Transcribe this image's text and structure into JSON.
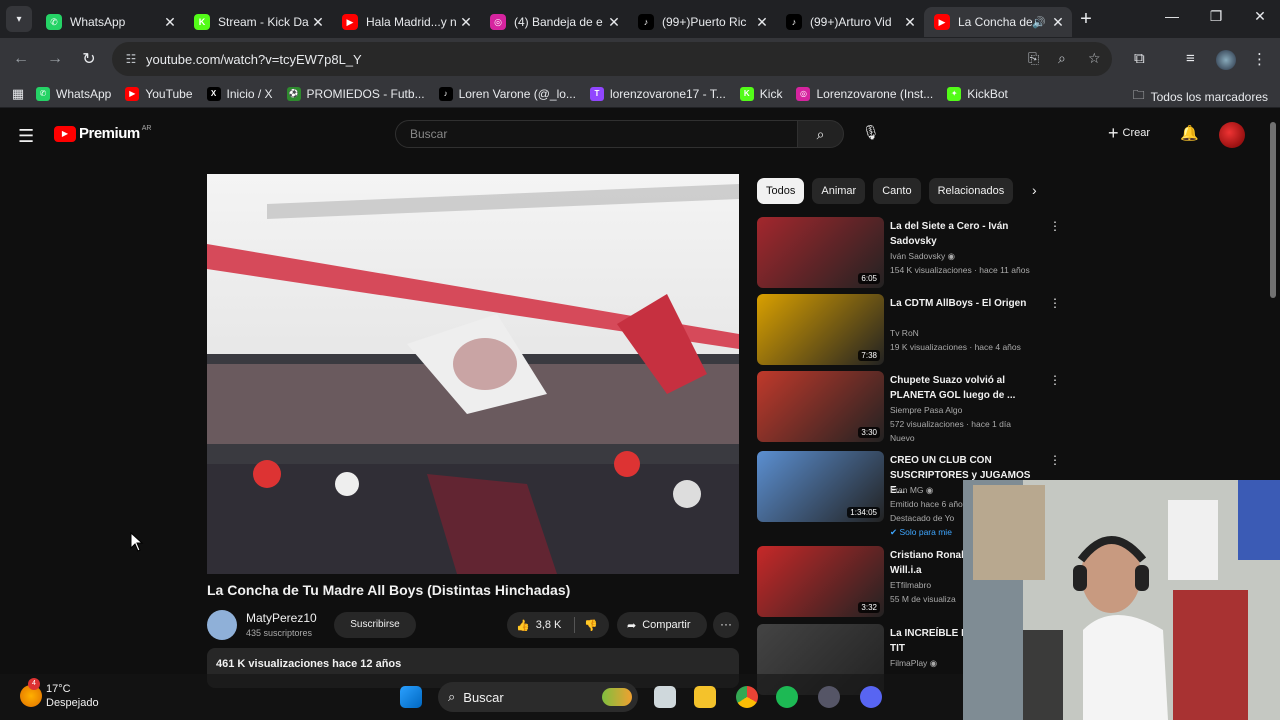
{
  "browser": {
    "tabs": [
      {
        "title": "WhatsApp",
        "favicon_color": "#25d366",
        "favicon_glyph": "✆",
        "active": false
      },
      {
        "title": "Stream - Kick Da",
        "favicon_color": "#53fc18",
        "favicon_glyph": "K",
        "active": false
      },
      {
        "title": "Hala Madrid...y n",
        "favicon_color": "#ff0000",
        "favicon_glyph": "▶",
        "active": false
      },
      {
        "title": "(4) Bandeja de e",
        "favicon_color": "#d6249f",
        "favicon_glyph": "◎",
        "active": false
      },
      {
        "title": "(99+)Puerto Ric",
        "favicon_color": "#000000",
        "favicon_glyph": "♪",
        "active": false
      },
      {
        "title": "(99+)Arturo Vid",
        "favicon_color": "#000000",
        "favicon_glyph": "♪",
        "active": false
      },
      {
        "title": "La Concha de",
        "favicon_color": "#ff0000",
        "favicon_glyph": "▶",
        "active": true
      }
    ],
    "url": "youtube.com/watch?v=tcyEW7p8L_Y",
    "bookmarks": [
      {
        "label": "WhatsApp",
        "favicon_color": "#25d366",
        "glyph": "✆"
      },
      {
        "label": "YouTube",
        "favicon_color": "#ff0000",
        "glyph": "▶"
      },
      {
        "label": "Inicio / X",
        "favicon_color": "#000000",
        "glyph": "X"
      },
      {
        "label": "PROMIEDOS - Futb...",
        "favicon_color": "#2e8b2e",
        "glyph": "⚽"
      },
      {
        "label": "Loren Varone (@_lo...",
        "favicon_color": "#000000",
        "glyph": "♪"
      },
      {
        "label": "lorenzovarone17 - T...",
        "favicon_color": "#9146ff",
        "glyph": "T"
      },
      {
        "label": "Kick",
        "favicon_color": "#53fc18",
        "glyph": "K"
      },
      {
        "label": "Lorenzovarone (Inst...",
        "favicon_color": "#d6249f",
        "glyph": "◎"
      },
      {
        "label": "KickBot",
        "favicon_color": "#53fc18",
        "glyph": "✦"
      }
    ],
    "all_bookmarks": "Todos los marcadores"
  },
  "youtube": {
    "logo_text": "Premium",
    "country_code": "AR",
    "search_placeholder": "Buscar",
    "create_label": "Crear",
    "video": {
      "title": "La Concha de Tu Madre All Boys (Distintas Hinchadas)",
      "channel": "MatyPerez10",
      "subscribers": "435 suscriptores",
      "subscribe_label": "Suscribirse",
      "likes": "3,8 K",
      "share_label": "Compartir",
      "views_date": "461 K visualizaciones  hace 12 años"
    },
    "chips": [
      "Todos",
      "Animar",
      "Canto",
      "Relacionados"
    ],
    "recommendations": [
      {
        "title": "La del Siete a Cero - Iván Sadovsky",
        "channel": "Iván Sadovsky",
        "verified": true,
        "meta": "154 K visualizaciones · hace 11 años",
        "extra": "",
        "duration": "6:05",
        "thumb": "#a3272d"
      },
      {
        "title": "La CDTM AllBoys - El Origen",
        "channel": "Tv RoN",
        "verified": false,
        "meta": "19 K visualizaciones · hace 4 años",
        "extra": "",
        "duration": "7:38",
        "thumb": "#d9a000"
      },
      {
        "title": "Chupete Suazo volvió al PLANETA GOL luego de ...",
        "channel": "Siempre Pasa Algo",
        "verified": false,
        "meta": "572 visualizaciones · hace 1 día",
        "extra": "Nuevo",
        "duration": "3:30",
        "thumb": "#c0392b"
      },
      {
        "title": "CREO UN CLUB CON SUSCRIPTORES y JUGAMOS E...",
        "channel": "Fran MG",
        "verified": true,
        "meta": "Emitido hace 6 años",
        "extra": "Destacado de Yo",
        "extra2": "✔ Solo para mie",
        "duration": "1:34:05",
        "thumb": "#5b8fd1"
      },
      {
        "title": "Cristiano Ronal Fame\"ft. Will.i.a",
        "channel": "ETfilmabro",
        "verified": false,
        "meta": "55 M de visualiza",
        "extra": "",
        "duration": "3:32",
        "thumb": "#c62828"
      },
      {
        "title": "La INCREÍBLE N ATTACK ON TIT",
        "channel": "FilmaPlay",
        "verified": true,
        "meta": "",
        "extra": "",
        "duration": "",
        "thumb": "#444444"
      }
    ]
  },
  "taskbar": {
    "weather_temp": "17°C",
    "weather_desc": "Despejado",
    "weather_badge": "4",
    "search_label": "Buscar"
  }
}
